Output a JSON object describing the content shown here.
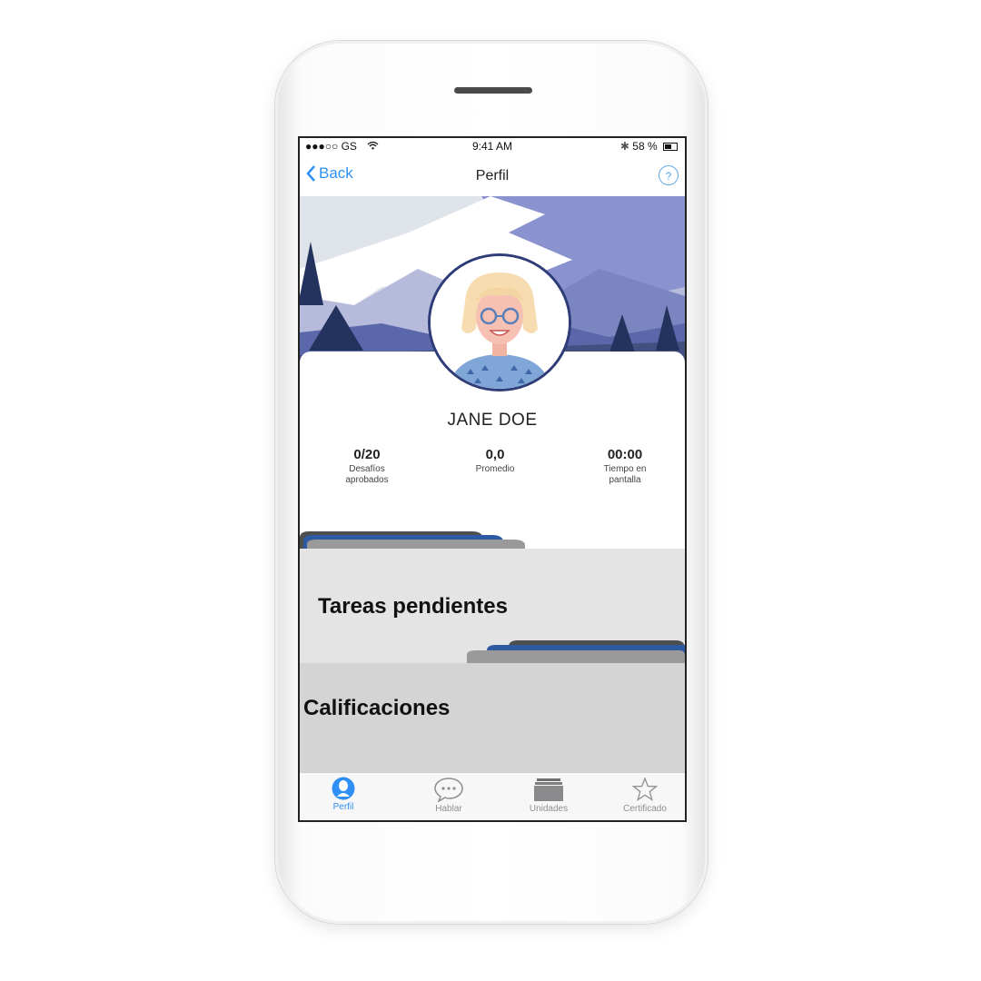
{
  "status_bar": {
    "carrier": "●●●○○ GS",
    "time": "9:41 AM",
    "battery": "58 %"
  },
  "nav": {
    "back_label": "Back",
    "title": "Perfil",
    "help_label": "?"
  },
  "profile": {
    "name": "JANE DOE",
    "stats": [
      {
        "value": "0/20",
        "label_line1": "Desafíos",
        "label_line2": "aprobados"
      },
      {
        "value": "0,0",
        "label_line1": "Promedio",
        "label_line2": ""
      },
      {
        "value": "00:00",
        "label_line1": "Tiempo en",
        "label_line2": "pantalla"
      }
    ]
  },
  "sections": [
    {
      "title": "Tareas pendientes"
    },
    {
      "title": "Calificaciones"
    }
  ],
  "tabbar": [
    {
      "label": "Perfil",
      "icon": "person-icon",
      "active": true
    },
    {
      "label": "Hablar",
      "icon": "chat-bubble-icon",
      "active": false
    },
    {
      "label": "Unidades",
      "icon": "folder-stack-icon",
      "active": false
    },
    {
      "label": "Certificado",
      "icon": "star-icon",
      "active": false
    }
  ],
  "colors": {
    "accent": "#2f8ff4",
    "avatar_border": "#2e3c77",
    "section_light": "#e4e4e4",
    "section_dark": "#d4d4d4"
  }
}
